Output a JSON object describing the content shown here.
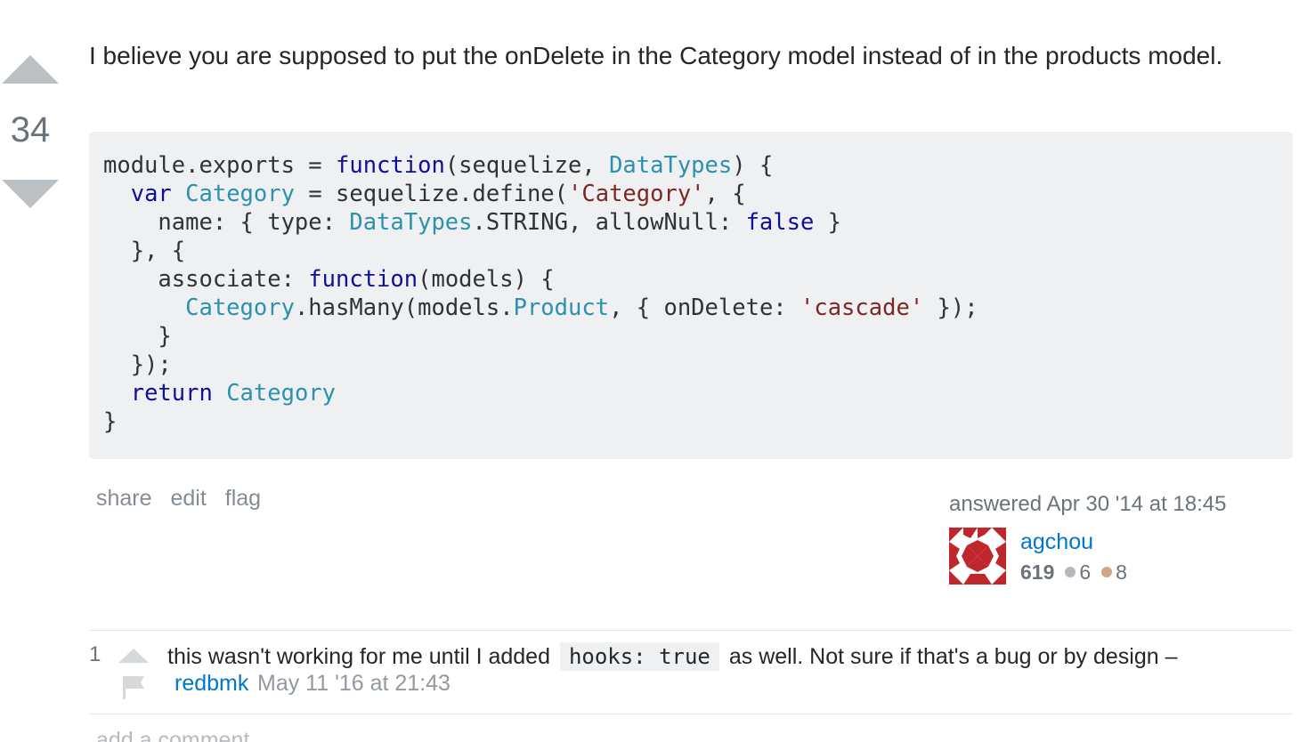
{
  "vote": {
    "count": "34",
    "up_icon": "triangle-up",
    "down_icon": "triangle-down"
  },
  "answer": {
    "text": "I believe you are supposed to put the onDelete in the Category model instead of in the products model."
  },
  "code": {
    "language": "javascript",
    "lines": [
      "module.exports = function(sequelize, DataTypes) {",
      "  var Category = sequelize.define('Category', {",
      "    name: { type: DataTypes.STRING, allowNull: false }",
      "  }, {",
      "    associate: function(models) {",
      "      Category.hasMany(models.Product, { onDelete: 'cascade' });",
      "    }",
      "  });",
      "  return Category",
      "}"
    ]
  },
  "post_menu": {
    "share": "share",
    "edit": "edit",
    "flag": "flag"
  },
  "user_card": {
    "action_time": "answered Apr 30 '14 at 18:45",
    "name": "agchou",
    "reputation": "619",
    "silver_badges": "6",
    "bronze_badges": "8",
    "colors": {
      "silver": "#b4b8bc",
      "bronze": "#d1a684",
      "gravatar": "#c0272d"
    }
  },
  "comment": {
    "score": "1",
    "text_before": "this wasn't working for me until I added",
    "code": "hooks: true",
    "text_after": "as well. Not sure if that's a bug or by design –",
    "user": "redbmk",
    "date": "May 11 '16 at 21:43",
    "up_icon": "triangle-up",
    "flag_icon": "flag"
  },
  "add_comment": "add a comment",
  "colors": {
    "link": "#0077cc",
    "code_bg": "#eff0f1",
    "keyword": "#101094",
    "type": "#2b91af",
    "string": "#7d2727",
    "vote_arrow": "#bbc0c4"
  }
}
